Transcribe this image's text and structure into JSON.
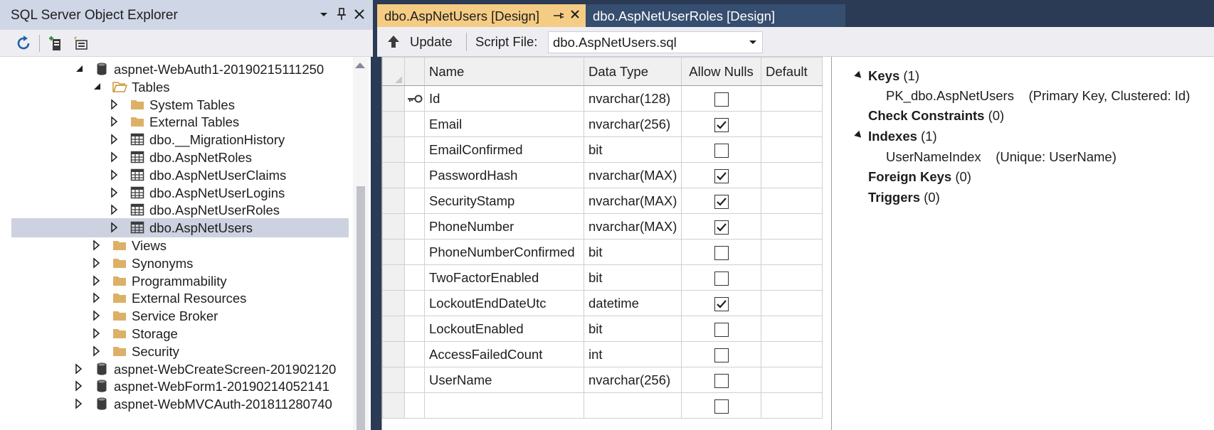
{
  "explorer": {
    "title": "SQL Server Object Explorer",
    "tree": [
      {
        "label": "aspnet-WebAuth1-20190215111250",
        "icon": "database-icon",
        "expander": "expanded"
      },
      {
        "label": "Tables",
        "icon": "folder-open-icon",
        "expander": "expanded"
      },
      {
        "label": "System Tables",
        "icon": "folder-icon",
        "expander": "collapsed"
      },
      {
        "label": "External Tables",
        "icon": "folder-icon",
        "expander": "collapsed"
      },
      {
        "label": "dbo.__MigrationHistory",
        "icon": "table-icon",
        "expander": "collapsed"
      },
      {
        "label": "dbo.AspNetRoles",
        "icon": "table-icon",
        "expander": "collapsed"
      },
      {
        "label": "dbo.AspNetUserClaims",
        "icon": "table-icon",
        "expander": "collapsed"
      },
      {
        "label": "dbo.AspNetUserLogins",
        "icon": "table-icon",
        "expander": "collapsed"
      },
      {
        "label": "dbo.AspNetUserRoles",
        "icon": "table-icon",
        "expander": "collapsed"
      },
      {
        "label": "dbo.AspNetUsers",
        "icon": "table-icon",
        "expander": "collapsed",
        "selected": true
      },
      {
        "label": "Views",
        "icon": "folder-icon",
        "expander": "collapsed"
      },
      {
        "label": "Synonyms",
        "icon": "folder-icon",
        "expander": "collapsed"
      },
      {
        "label": "Programmability",
        "icon": "folder-icon",
        "expander": "collapsed"
      },
      {
        "label": "External Resources",
        "icon": "folder-icon",
        "expander": "collapsed"
      },
      {
        "label": "Service Broker",
        "icon": "folder-icon",
        "expander": "collapsed"
      },
      {
        "label": "Storage",
        "icon": "folder-icon",
        "expander": "collapsed"
      },
      {
        "label": "Security",
        "icon": "folder-icon",
        "expander": "collapsed"
      },
      {
        "label": "aspnet-WebCreateScreen-201902120",
        "icon": "database-icon",
        "expander": "collapsed"
      },
      {
        "label": "aspnet-WebForm1-20190214052141",
        "icon": "database-icon",
        "expander": "collapsed"
      },
      {
        "label": "aspnet-WebMVCAuth-201811280740",
        "icon": "database-icon",
        "expander": "collapsed"
      }
    ]
  },
  "tabs": {
    "active": "dbo.AspNetUsers [Design]",
    "inactive": "dbo.AspNetUserRoles [Design]"
  },
  "toolbar": {
    "update_label": "Update",
    "script_label": "Script File:",
    "script_value": "dbo.AspNetUsers.sql"
  },
  "grid": {
    "headers": {
      "name": "Name",
      "type": "Data Type",
      "nulls": "Allow Nulls",
      "default": "Default"
    },
    "rows": [
      {
        "name": "Id",
        "type": "nvarchar(128)",
        "allow_nulls": false,
        "primary_key": true
      },
      {
        "name": "Email",
        "type": "nvarchar(256)",
        "allow_nulls": true
      },
      {
        "name": "EmailConfirmed",
        "type": "bit",
        "allow_nulls": false
      },
      {
        "name": "PasswordHash",
        "type": "nvarchar(MAX)",
        "allow_nulls": true
      },
      {
        "name": "SecurityStamp",
        "type": "nvarchar(MAX)",
        "allow_nulls": true
      },
      {
        "name": "PhoneNumber",
        "type": "nvarchar(MAX)",
        "allow_nulls": true
      },
      {
        "name": "PhoneNumberConfirmed",
        "type": "bit",
        "allow_nulls": false
      },
      {
        "name": "TwoFactorEnabled",
        "type": "bit",
        "allow_nulls": false
      },
      {
        "name": "LockoutEndDateUtc",
        "type": "datetime",
        "allow_nulls": true
      },
      {
        "name": "LockoutEnabled",
        "type": "bit",
        "allow_nulls": false
      },
      {
        "name": "AccessFailedCount",
        "type": "int",
        "allow_nulls": false
      },
      {
        "name": "UserName",
        "type": "nvarchar(256)",
        "allow_nulls": false
      },
      {
        "name": "",
        "type": "",
        "allow_nulls": false
      }
    ]
  },
  "properties": {
    "keys": {
      "label": "Keys",
      "count": "(1)",
      "item_name": "PK_dbo.AspNetUsers",
      "item_desc": "(Primary Key, Clustered: Id)"
    },
    "check": {
      "label": "Check Constraints",
      "count": "(0)"
    },
    "indexes": {
      "label": "Indexes",
      "count": "(1)",
      "item_name": "UserNameIndex",
      "item_desc": "(Unique: UserName)"
    },
    "foreign": {
      "label": "Foreign Keys",
      "count": "(0)"
    },
    "triggers": {
      "label": "Triggers",
      "count": "(0)"
    }
  },
  "colors": {
    "title_bar": "#cfd6e5",
    "active_tab": "#f5cc84",
    "inactive_tab": "#364e6f",
    "frame": "#2b3a55",
    "selection": "#ccd2df",
    "folder": "#dcb067"
  }
}
